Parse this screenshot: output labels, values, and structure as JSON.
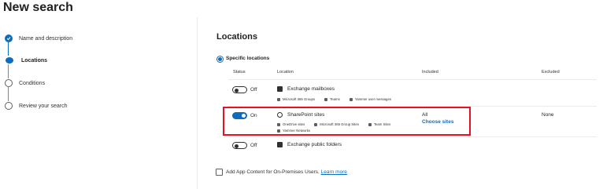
{
  "page": {
    "title": "New search"
  },
  "steps": [
    {
      "label": "Name and description",
      "state": "done"
    },
    {
      "label": "Locations",
      "state": "current"
    },
    {
      "label": "Conditions",
      "state": "todo"
    },
    {
      "label": "Review your search",
      "state": "todo"
    }
  ],
  "main": {
    "section_title": "Locations",
    "radio_label": "Specific locations",
    "columns": {
      "status": "Status",
      "location": "Location",
      "included": "Included",
      "excluded": "Excluded"
    },
    "rows": [
      {
        "toggle_state": "Off",
        "icon": "exchange-icon",
        "name": "Exchange mailboxes",
        "sub_items": [
          "Microsoft 365 Groups",
          "Teams",
          "Yammer user messages"
        ],
        "included": "",
        "included_link": "",
        "excluded": ""
      },
      {
        "toggle_state": "On",
        "icon": "sharepoint-icon",
        "name": "SharePoint sites",
        "sub_items": [
          "OneDrive sites",
          "Microsoft 365 Group Sites",
          "Team Sites"
        ],
        "sub_items_2": [
          "Yammer Networks"
        ],
        "included": "All",
        "included_link": "Choose sites",
        "excluded": "None"
      },
      {
        "toggle_state": "Off",
        "icon": "exchange-icon",
        "name": "Exchange public folders",
        "sub_items": [],
        "included": "",
        "included_link": "",
        "excluded": ""
      }
    ],
    "checkbox_label": "Add App Content for On-Premises Users.",
    "checkbox_link": "Learn more"
  },
  "colors": {
    "accent": "#0f6cbd",
    "highlight_border": "#e81123"
  }
}
